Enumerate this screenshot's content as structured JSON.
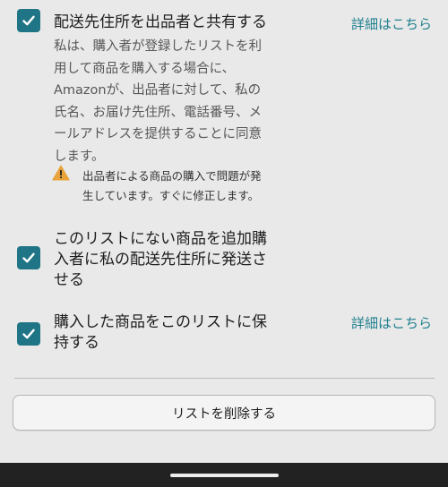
{
  "options": [
    {
      "title": "配送先住所を出品者と共有する",
      "link": "詳細はこちら",
      "checked": true,
      "description_lines": [
        "私は、購入者が登録したリストを利",
        "用して商品を購入する場合に、",
        "Amazonが、出品者に対して、私の",
        "氏名、お届け先住所、電話番号、メ",
        "ールアドレスを提供することに同意",
        "します。"
      ],
      "warning_lines": [
        "出品者による商品の購入で問題が発",
        "生しています。すぐに修正します。"
      ]
    },
    {
      "title_lines": [
        "このリストにない商品を追加購",
        "入者に私の配送先住所に発送さ",
        "せる"
      ],
      "checked": true
    },
    {
      "title_lines": [
        "購入した商品をこのリストに保",
        "持する"
      ],
      "link": "詳細はこちら",
      "checked": true
    }
  ],
  "delete_button_label": "リストを削除する",
  "colors": {
    "checkbox": "#1f7585",
    "link": "#1f7f8e",
    "warning": "#e8a33a"
  },
  "icons": [
    "checkmark-icon",
    "warning-icon"
  ]
}
